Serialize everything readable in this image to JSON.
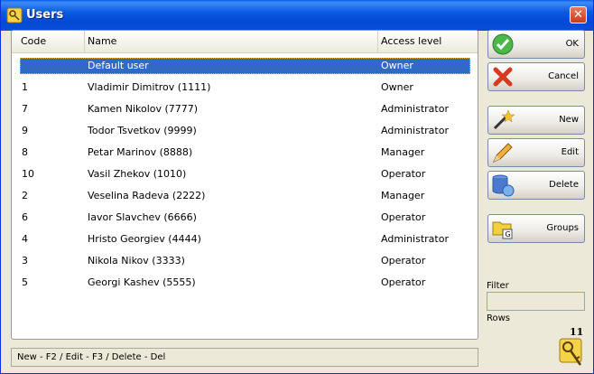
{
  "window": {
    "title": "Users",
    "close_glyph": "✕"
  },
  "grid": {
    "headers": {
      "code": "Code",
      "name": "Name",
      "access": "Access level"
    },
    "rows": [
      {
        "code": "",
        "name": "Default user",
        "access": "Owner",
        "selected": true
      },
      {
        "code": "1",
        "name": "Vladimir Dimitrov (1111)",
        "access": "Owner"
      },
      {
        "code": "7",
        "name": "Kamen Nikolov (7777)",
        "access": "Administrator"
      },
      {
        "code": "9",
        "name": "Todor Tsvetkov (9999)",
        "access": "Administrator"
      },
      {
        "code": "8",
        "name": "Petar Marinov (8888)",
        "access": "Manager"
      },
      {
        "code": "10",
        "name": "Vasil Zhekov (1010)",
        "access": "Operator"
      },
      {
        "code": "2",
        "name": "Veselina Radeva (2222)",
        "access": "Manager"
      },
      {
        "code": "6",
        "name": "Iavor Slavchev (6666)",
        "access": "Operator"
      },
      {
        "code": "4",
        "name": "Hristo Georgiev (4444)",
        "access": "Administrator"
      },
      {
        "code": "3",
        "name": "Nikola Nikov (3333)",
        "access": "Operator"
      },
      {
        "code": "5",
        "name": "Georgi Kashev (5555)",
        "access": "Operator"
      }
    ]
  },
  "statusbar": {
    "hint": "New - F2 / Edit - F3 / Delete - Del"
  },
  "buttons": {
    "ok": "OK",
    "cancel": "Cancel",
    "new": "New",
    "edit": "Edit",
    "delete": "Delete",
    "groups": "Groups"
  },
  "icons": {
    "ok": "checkmark-icon",
    "cancel": "x-mark-icon",
    "new": "magic-wand-icon",
    "edit": "pencil-icon",
    "delete": "database-delete-icon",
    "groups": "folder-g-icon"
  },
  "filter": {
    "label": "Filter",
    "value": ""
  },
  "rows_info": {
    "label": "Rows",
    "count": "11"
  },
  "colors": {
    "title_bar": "#0a5ae0",
    "selection": "#316ac5",
    "close": "#c83c1c"
  }
}
